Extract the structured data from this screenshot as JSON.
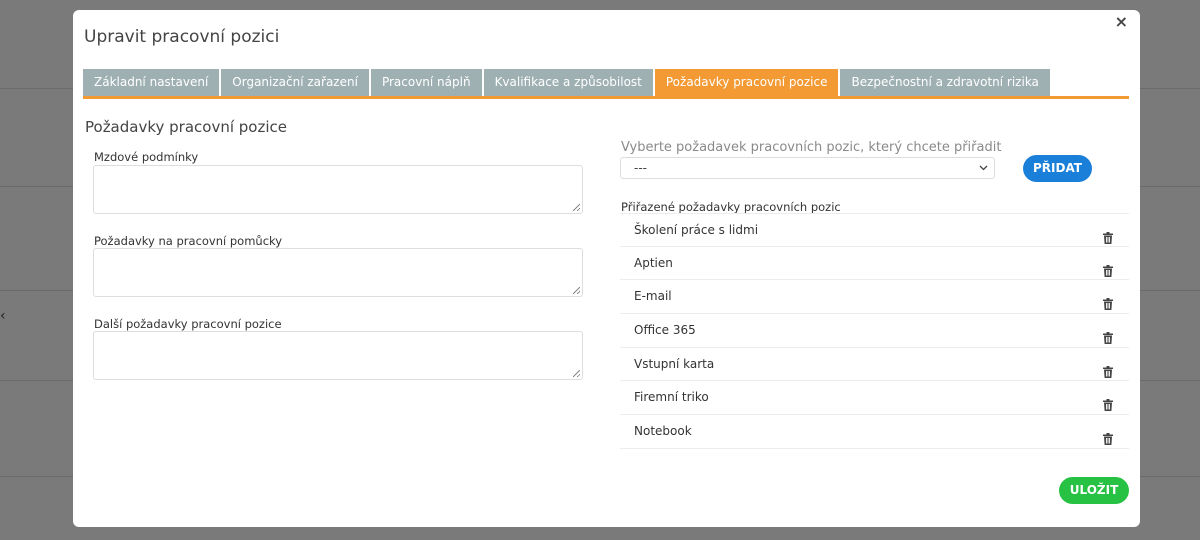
{
  "modal": {
    "title": "Upravit pracovní pozici",
    "close_icon": "close-icon",
    "close_glyph": "×"
  },
  "tabs": [
    {
      "label": "Základní nastavení",
      "active": false
    },
    {
      "label": "Organizační zařazení",
      "active": false
    },
    {
      "label": "Pracovní náplň",
      "active": false
    },
    {
      "label": "Kvalifikace a způsobilost",
      "active": false
    },
    {
      "label": "Požadavky pracovní pozice",
      "active": true
    },
    {
      "label": "Bezpečnostní a zdravotní rizika",
      "active": false
    }
  ],
  "form": {
    "section_title": "Požadavky pracovní pozice",
    "fields": [
      {
        "label": "Mzdové podmínky",
        "value": ""
      },
      {
        "label": "Požadavky na pracovní pomůcky",
        "value": ""
      },
      {
        "label": "Další požadavky pracovní pozice",
        "value": ""
      }
    ]
  },
  "assign": {
    "prompt": "Vyberte požadavek pracovních pozic, který chcete přiřadit",
    "selected": "---",
    "add_label": "PŘIDAT",
    "assigned_label": "Přiřazené požadavky pracovních pozic",
    "items": [
      "Školení práce s lidmi",
      "Aptien",
      "E-mail",
      "Office 365",
      "Vstupní karta",
      "Firemní triko",
      "Notebook"
    ]
  },
  "save_label": "ULOŽIT",
  "colors": {
    "accent": "#f39a35",
    "tab_inactive": "#9fb0b3",
    "add_button": "#1a7fd9",
    "save_button": "#27c244"
  }
}
